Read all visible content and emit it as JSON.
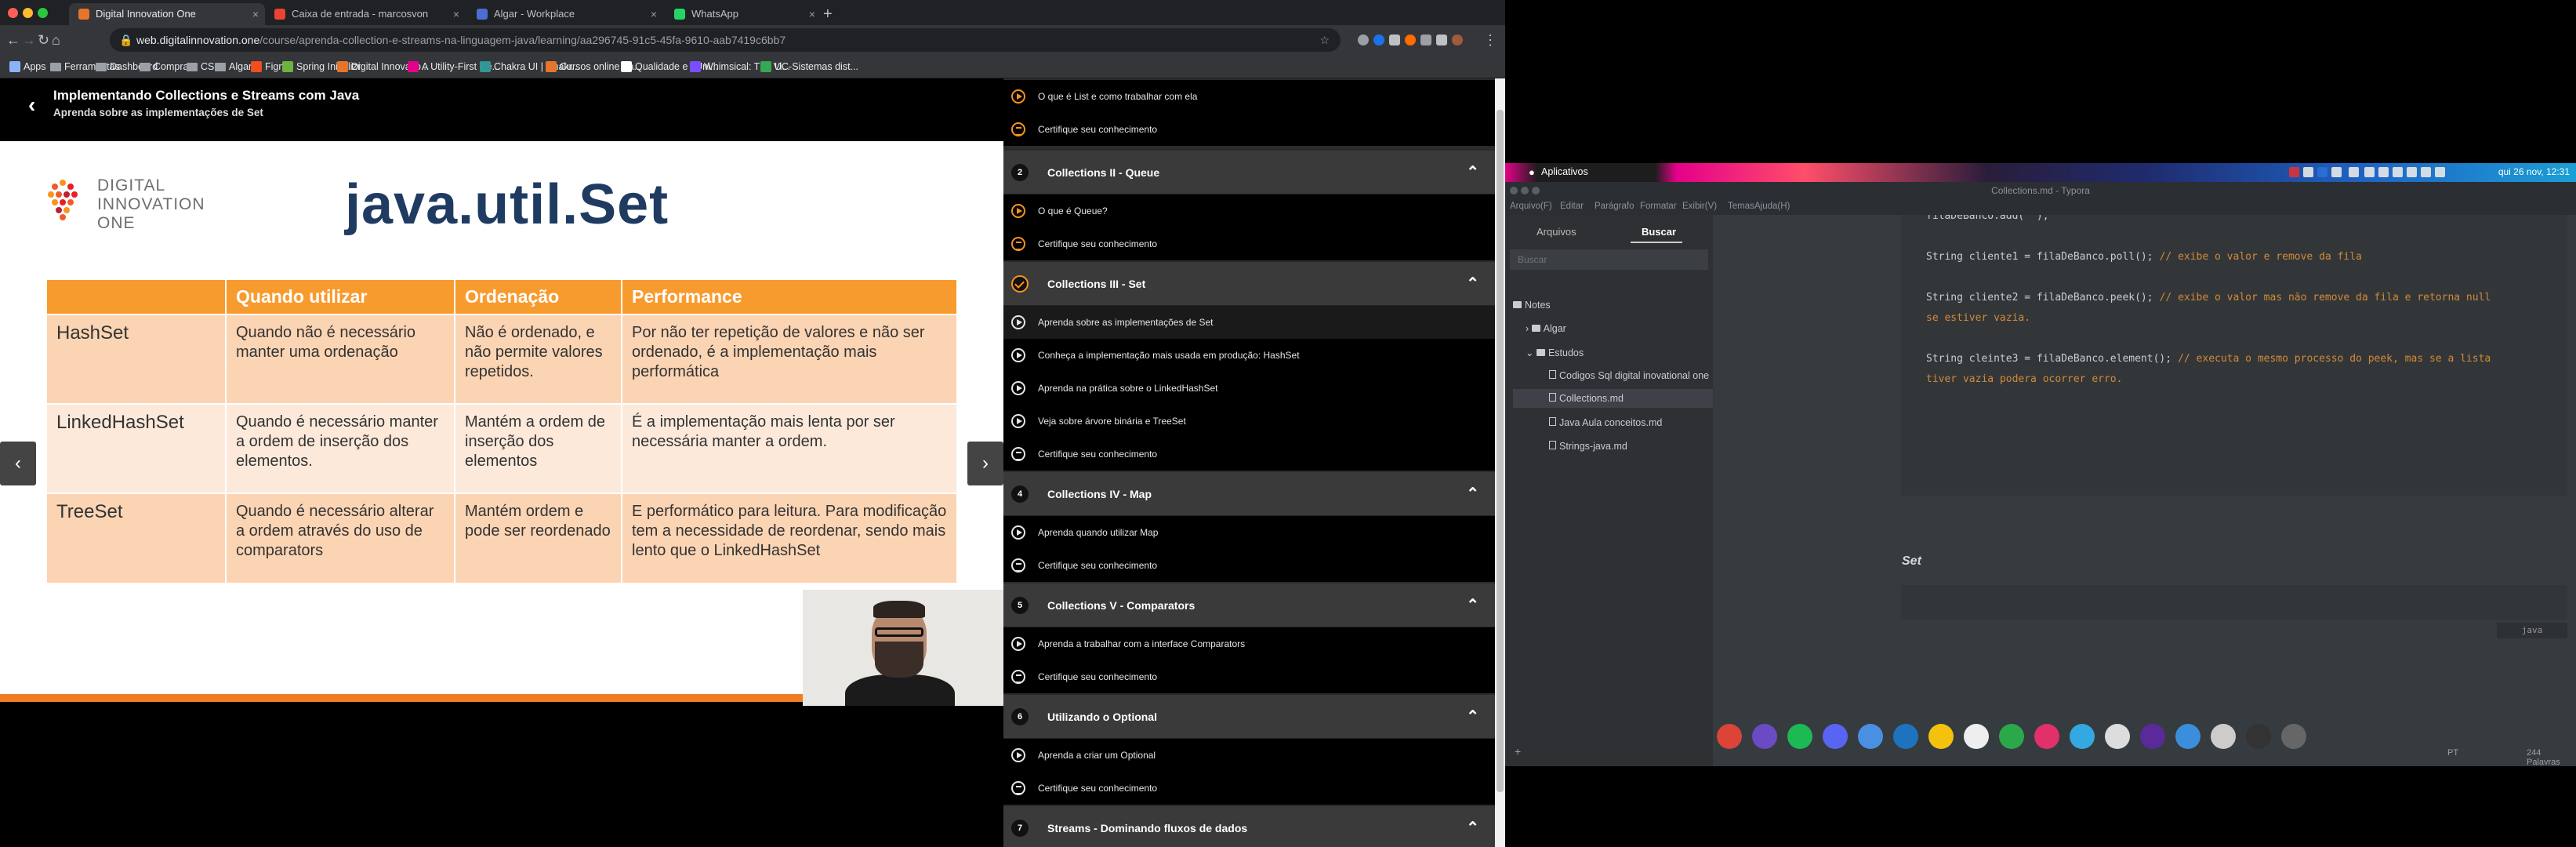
{
  "browser": {
    "tabs": [
      {
        "title": "Digital Innovation One",
        "color": "#e8742b"
      },
      {
        "title": "Caixa de entrada - marcosvon",
        "color": "#ea4335"
      },
      {
        "title": "Algar - Workplace",
        "color": "#4a6fd4"
      },
      {
        "title": "WhatsApp",
        "color": "#25d366"
      }
    ],
    "url_host": "web.digitalinnovation.one",
    "url_path": "/course/aprenda-collection-e-streams-na-linguagem-java/learning/aa296745-91c5-45fa-9610-aab7419c6bb7",
    "bookmarks": [
      {
        "label": "Apps",
        "type": "apps"
      },
      {
        "label": "Ferramentas",
        "type": "folder"
      },
      {
        "label": "Dashboard",
        "type": "folder"
      },
      {
        "label": "Compras",
        "type": "folder"
      },
      {
        "label": "CSS",
        "type": "folder"
      },
      {
        "label": "Algar",
        "type": "folder"
      },
      {
        "label": "Figma",
        "type": "site",
        "color": "#f24e1e"
      },
      {
        "label": "Spring Initializr",
        "type": "site",
        "color": "#6db33f"
      },
      {
        "label": "Digital Innovatio...",
        "type": "site",
        "color": "#e8742b"
      },
      {
        "label": "A Utility-First Re...",
        "type": "site",
        "color": "#e5008a"
      },
      {
        "label": "Chakra UI | Chakr...",
        "type": "site",
        "color": "#319795"
      },
      {
        "label": "Cursos online - a...",
        "type": "site",
        "color": "#e8742b"
      },
      {
        "label": "Qualidade e JUni...",
        "type": "site",
        "color": "#ffffff"
      },
      {
        "label": "Whimsical: The Vi...",
        "type": "site",
        "color": "#7c4dff"
      },
      {
        "label": "UC-Sistemas dist...",
        "type": "site",
        "color": "#34a853"
      }
    ]
  },
  "course": {
    "title": "Implementando Collections e Streams com Java",
    "subtitle": "Aprenda sobre as implementações de Set",
    "back_icon": "chevron-left-icon"
  },
  "slide": {
    "logo_line1": "DIGITAL",
    "logo_line2": "INNOVATION",
    "logo_line3": "ONE",
    "title": "java.util.Set",
    "headers": [
      "",
      "Quando utilizar",
      "Ordenação",
      "Performance"
    ],
    "rows": [
      {
        "name": "HashSet",
        "when": "Quando não é necessário manter uma ordenação",
        "order": "Não é ordenado, e não permite valores repetidos.",
        "perf": "Por não ter repetição de valores e não ser ordenado, é a implementação mais performática"
      },
      {
        "name": "LinkedHashSet",
        "when": "Quando é necessário manter a ordem de inserção dos elementos.",
        "order": "Mantém a ordem de inserção dos elementos",
        "perf": "É a implementação mais lenta por ser necessária manter a ordem."
      },
      {
        "name": "TreeSet",
        "when": "Quando é necessário alterar a ordem através do uso de comparators",
        "order": "Mantém ordem e pode ser reordenado",
        "perf": "E performático para leitura. Para modificação tem a necessidade de reordenar, sendo mais lento que o LinkedHashSet"
      }
    ],
    "prev_label": "‹",
    "next_label": "›"
  },
  "sidebar": {
    "top_lessons": [
      {
        "label": "O que é List e como trabalhar com ela",
        "kind": "play"
      },
      {
        "label": "Certifique seu conhecimento",
        "kind": "quiz"
      }
    ],
    "modules": [
      {
        "num": "2",
        "title": "Collections II - Queue",
        "lessons": [
          {
            "label": "O que é Queue?",
            "kind": "play"
          },
          {
            "label": "Certifique seu conhecimento",
            "kind": "quiz"
          }
        ]
      },
      {
        "num": "",
        "title": "Collections III - Set",
        "lessons": [
          {
            "label": "Aprenda sobre as implementações de Set",
            "kind": "play"
          },
          {
            "label": "Conheça a implementação mais usada em produção: HashSet",
            "kind": "play"
          },
          {
            "label": "Aprenda na prática sobre o LinkedHashSet",
            "kind": "play"
          },
          {
            "label": "Veja sobre árvore binária e TreeSet",
            "kind": "play"
          },
          {
            "label": "Certifique seu conhecimento",
            "kind": "quiz"
          }
        ]
      },
      {
        "num": "4",
        "title": "Collections IV - Map",
        "lessons": [
          {
            "label": "Aprenda quando utilizar Map",
            "kind": "play"
          },
          {
            "label": "Certifique seu conhecimento",
            "kind": "quiz"
          }
        ]
      },
      {
        "num": "5",
        "title": "Collections V - Comparators",
        "lessons": [
          {
            "label": "Aprenda a trabalhar com a interface Comparators",
            "kind": "play"
          },
          {
            "label": "Certifique seu conhecimento",
            "kind": "quiz"
          }
        ]
      },
      {
        "num": "6",
        "title": "Utilizando o Optional",
        "lessons": [
          {
            "label": "Aprenda a criar um Optional",
            "kind": "play"
          },
          {
            "label": "Certifique seu conhecimento",
            "kind": "quiz"
          }
        ]
      },
      {
        "num": "7",
        "title": "Streams - Dominando fluxos de dados",
        "lessons": []
      }
    ]
  },
  "desktop": {
    "apps_label": "Aplicativos",
    "clock": "qui 26 nov, 12:31"
  },
  "typora": {
    "window_title": "Collections.md - Typora",
    "menu": [
      "Arquivo(F)",
      "Editar",
      "Parágrafo",
      "Formatar",
      "Exibir(V)",
      "Temas",
      "Ajuda(H)"
    ],
    "tab_files": "Arquivos",
    "tab_search": "Buscar",
    "search_placeholder": "Buscar",
    "tree": {
      "root": "Notes",
      "items": [
        "Algar",
        "Estudos",
        "Codigos Sql digital inovational one",
        "Collections.md",
        "Java Aula conceitos.md",
        "Strings-java.md"
      ]
    },
    "code_lines": [
      {
        "code": "filaDeBanco.add(\"\");",
        "comment": ""
      },
      {
        "code": "",
        "comment": ""
      },
      {
        "code": "String cliente1 = filaDeBanco.poll();",
        "comment": "// exibe o valor e remove da fila"
      },
      {
        "code": "",
        "comment": ""
      },
      {
        "code": "String cliente2 = filaDeBanco.peek();",
        "comment": "// exibe o valor mas não remove da fila e retorna null"
      },
      {
        "code": "",
        "comment": "se estiver vazia."
      },
      {
        "code": "",
        "comment": ""
      },
      {
        "code": "String cleinte3 = filaDeBanco.element();",
        "comment": "// executa o mesmo processo do peek, mas se a lista"
      },
      {
        "code": "",
        "comment": "tiver vazia podera ocorrer erro."
      }
    ],
    "heading": "Set",
    "lang_tag": "java",
    "add_label": "+",
    "status": "PT",
    "word_count": "244 Palavras"
  }
}
